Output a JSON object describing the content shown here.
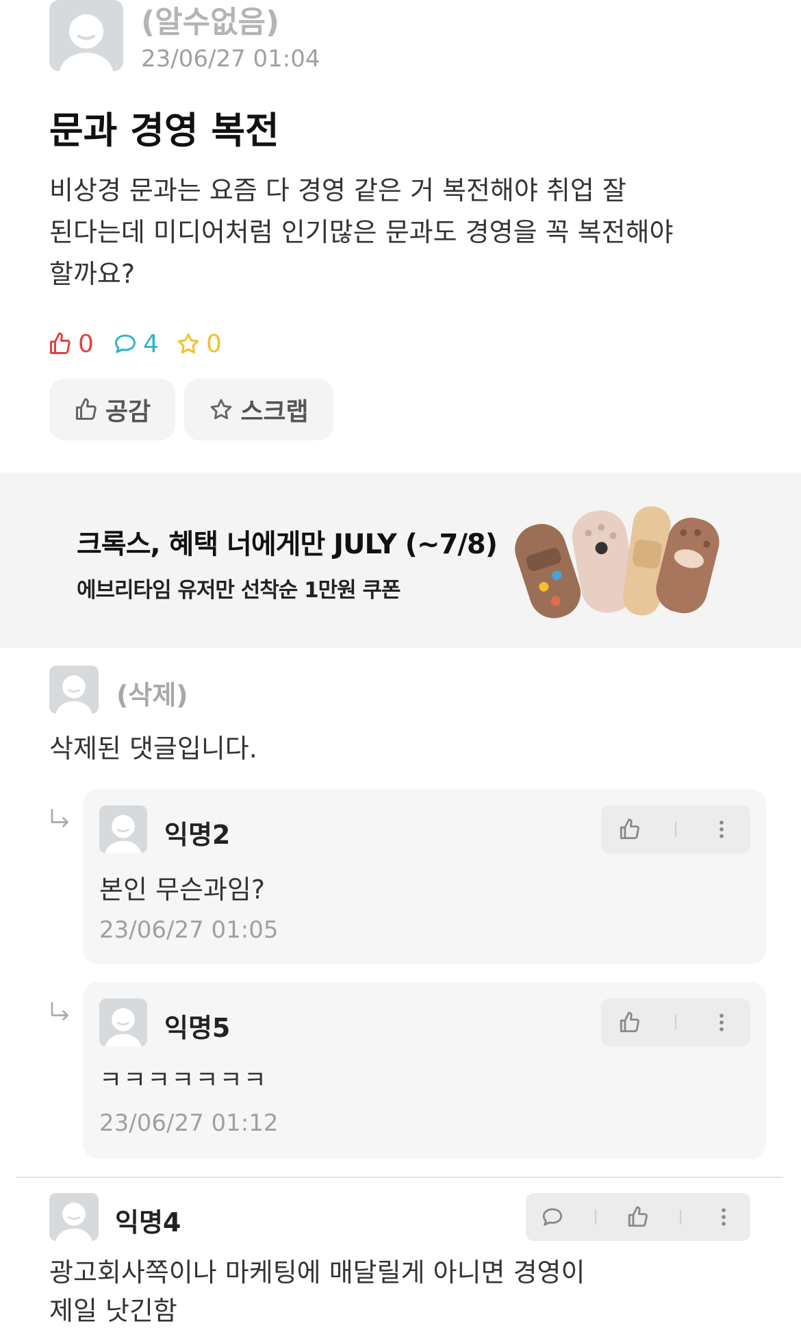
{
  "post": {
    "author": "(알수없음)",
    "timestamp": "23/06/27 01:04",
    "title": "문과 경영 복전",
    "body_lines": [
      "비상경 문과는 요즘 다 경영 같은 거 복전해야 취업 잘",
      "된다는데 미디어처럼 인기많은 문과도 경영을 꼭 복전해야",
      "할까요?"
    ],
    "likes": "0",
    "comments": "4",
    "scraps": "0",
    "like_button": "공감",
    "scrap_button": "스크랩"
  },
  "ad": {
    "title": "크록스, 혜택 너에게만 JULY (~7/8)",
    "subtitle": "에브리타임 유저만 선착순 1만원 쿠폰"
  },
  "comments": [
    {
      "author": "(삭제)",
      "text": "삭제된 댓글입니다.",
      "replies": [
        {
          "author": "익명2",
          "text": "본인 무슨과임?",
          "timestamp": "23/06/27 01:05"
        },
        {
          "author": "익명5",
          "text": "ㅋㅋㅋㅋㅋㅋㅋ",
          "timestamp": "23/06/27 01:12"
        }
      ]
    },
    {
      "author": "익명4",
      "text_lines": [
        "광고회사쪽이나 마케팅에 매달릴게 아니면 경영이",
        "제일 낫긴함"
      ]
    }
  ],
  "colors": {
    "like_red": "#e1413f",
    "comment_teal": "#2fb5c4",
    "scrap_yellow": "#f2c12e",
    "avatar_gray": "#d7dadd"
  }
}
